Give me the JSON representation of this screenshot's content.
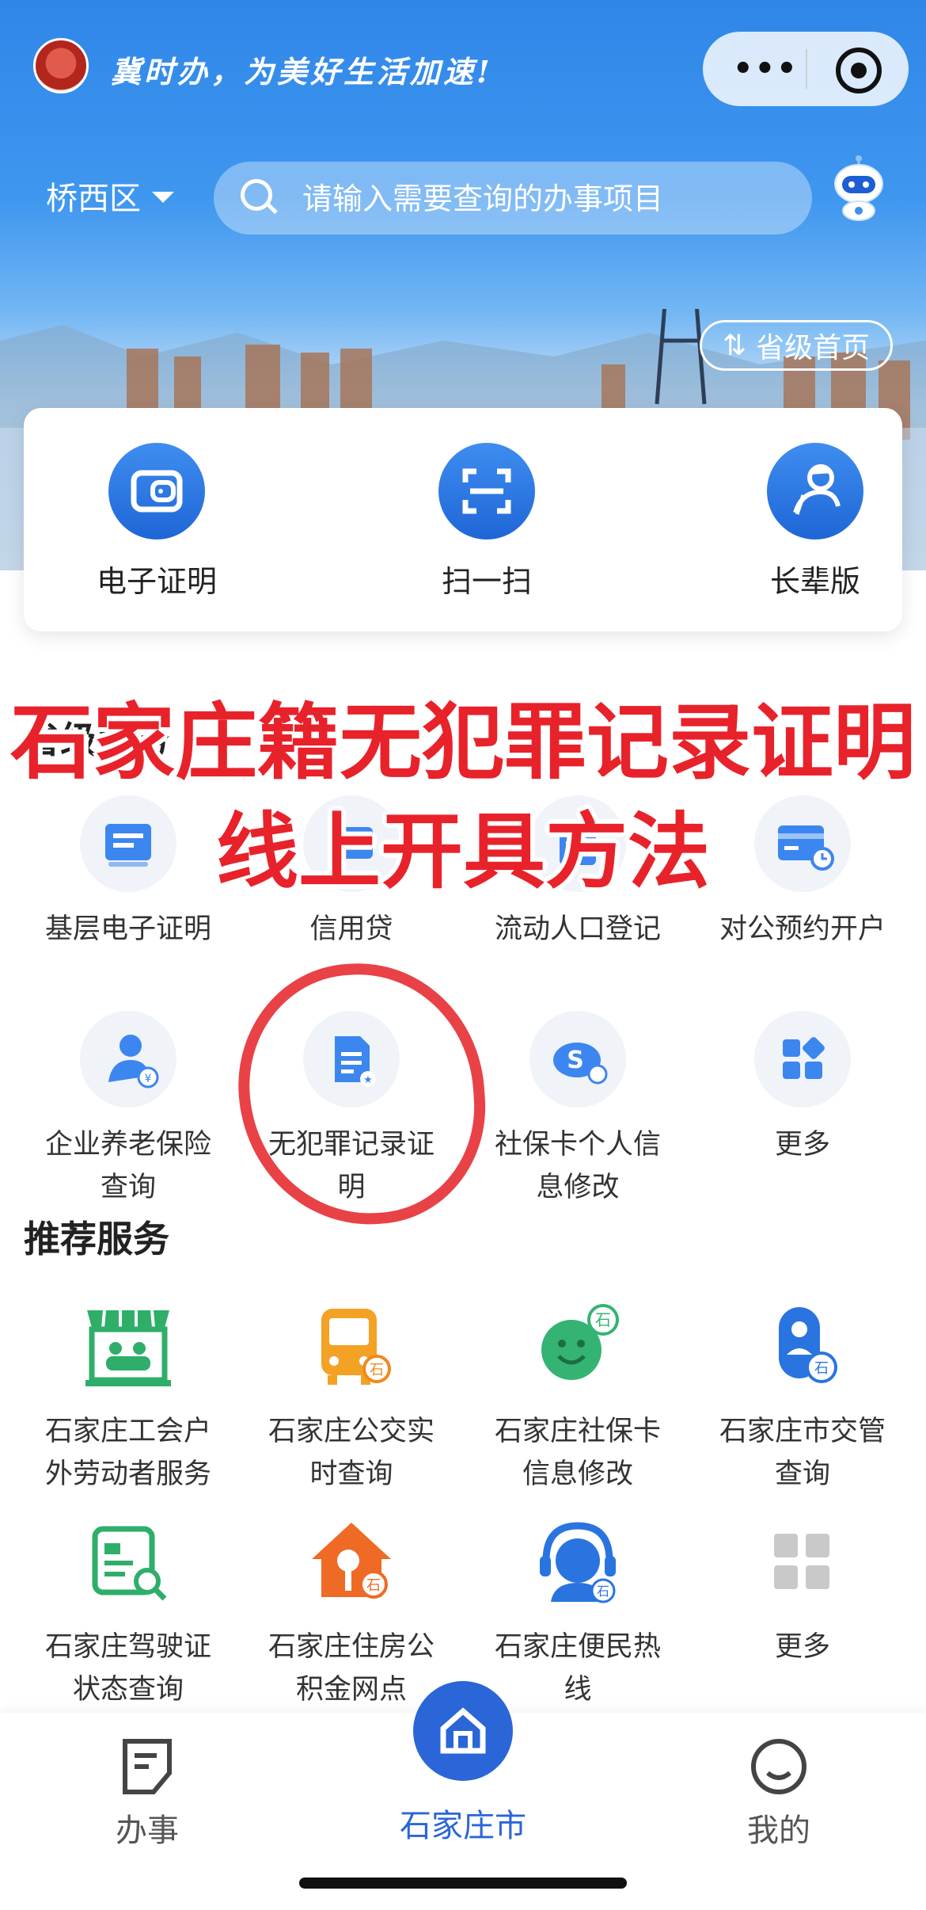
{
  "header": {
    "slogan": "冀时办，为美好生活加速!",
    "menu_dots": "•••",
    "district": "桥西区",
    "search_placeholder": "请输入需要查询的办事项目",
    "province_home": "省级首页"
  },
  "quick_actions": [
    {
      "label": "电子证明",
      "icon": "wallet-icon"
    },
    {
      "label": "扫一扫",
      "icon": "scan-icon"
    },
    {
      "label": "长辈版",
      "icon": "elder-icon"
    }
  ],
  "overlay": {
    "line1": "石家庄籍无犯罪记录证明",
    "line2": "线上开具方法"
  },
  "provincial": {
    "title": "省级服务",
    "items": [
      {
        "label": "基层电子证明",
        "icon": "certificate-icon"
      },
      {
        "label": "信用贷",
        "icon": "credit-icon"
      },
      {
        "label": "流动人口登记",
        "icon": "person-register-icon"
      },
      {
        "label": "对公预约开户",
        "icon": "calendar-card-icon"
      },
      {
        "label": "企业养老保险查询",
        "icon": "pension-icon"
      },
      {
        "label": "无犯罪记录证明",
        "icon": "document-icon"
      },
      {
        "label": "社保卡个人信息修改",
        "icon": "social-card-icon"
      },
      {
        "label": "更多",
        "icon": "grid-icon"
      }
    ]
  },
  "recommended": {
    "title": "推荐服务",
    "items": [
      {
        "label": "石家庄工会户外劳动者服务",
        "icon": "station-icon"
      },
      {
        "label": "石家庄公交实时查询",
        "icon": "bus-icon"
      },
      {
        "label": "石家庄社保卡信息修改",
        "icon": "smile-icon"
      },
      {
        "label": "石家庄市交管查询",
        "icon": "police-icon"
      },
      {
        "label": "石家庄驾驶证状态查询",
        "icon": "license-icon"
      },
      {
        "label": "石家庄住房公积金网点",
        "icon": "house-key-icon"
      },
      {
        "label": "石家庄便民热线",
        "icon": "headset-icon"
      },
      {
        "label": "更多",
        "icon": "grid-icon"
      }
    ]
  },
  "tabbar": {
    "tab1": "办事",
    "tab2": "石家庄市",
    "tab3": "我的"
  },
  "colors": {
    "brand_blue": "#2a66d8",
    "overlay_red": "#e8222a",
    "green": "#2fae6a",
    "orange": "#f08a1c"
  }
}
